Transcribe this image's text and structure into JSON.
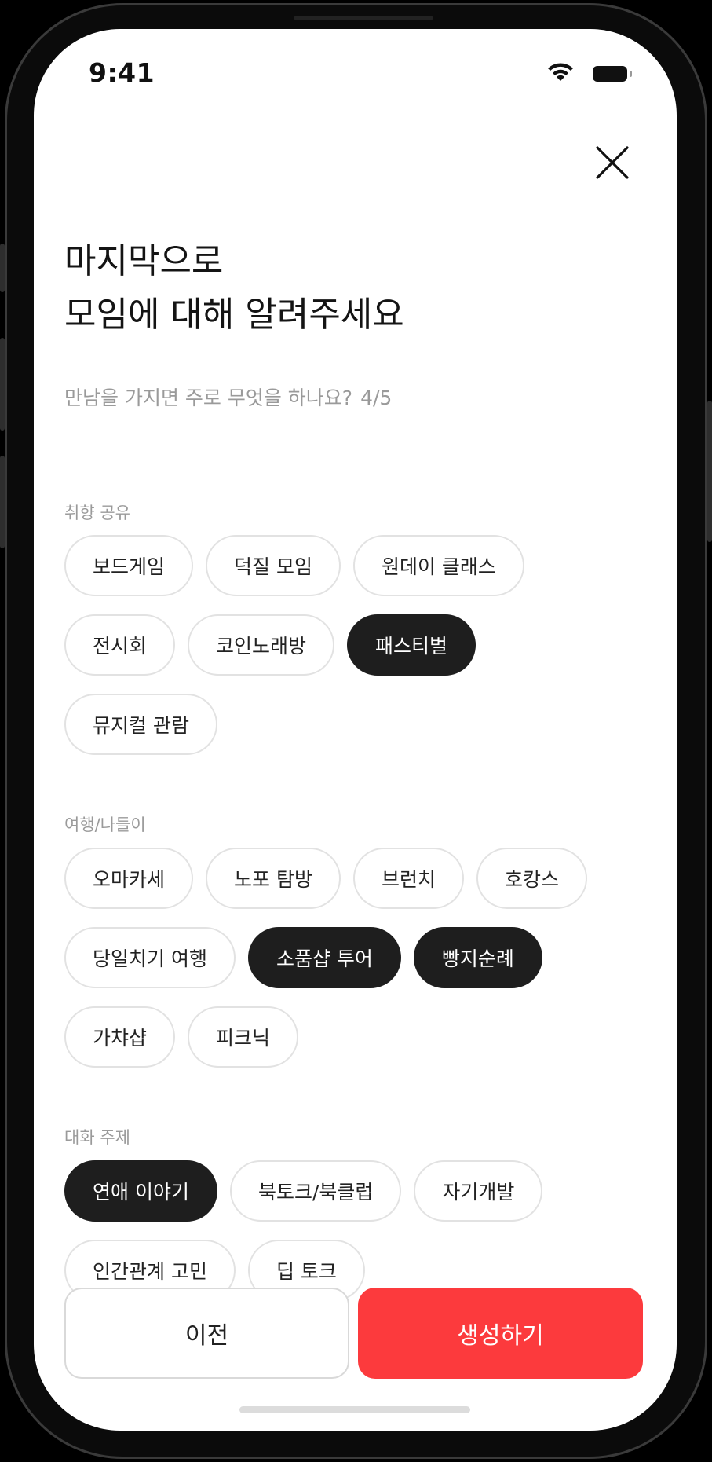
{
  "status_bar": {
    "time": "9:41"
  },
  "header": {
    "title_line1": "마지막으로",
    "title_line2": "모임에 대해 알려주세요",
    "subtitle": "만남을 가지면 주로 무엇을 하나요?",
    "step": "4/5"
  },
  "sections": [
    {
      "label": "취향 공유",
      "chips": [
        {
          "label": "보드게임",
          "selected": false
        },
        {
          "label": "덕질 모임",
          "selected": false
        },
        {
          "label": "원데이 클래스",
          "selected": false
        },
        {
          "label": "전시회",
          "selected": false
        },
        {
          "label": "코인노래방",
          "selected": false
        },
        {
          "label": "패스티벌",
          "selected": true
        },
        {
          "label": "뮤지컬 관람",
          "selected": false
        }
      ]
    },
    {
      "label": "여행/나들이",
      "chips": [
        {
          "label": "오마카세",
          "selected": false
        },
        {
          "label": "노포 탐방",
          "selected": false
        },
        {
          "label": "브런치",
          "selected": false
        },
        {
          "label": "호캉스",
          "selected": false
        },
        {
          "label": "당일치기 여행",
          "selected": false
        },
        {
          "label": "소품샵 투어",
          "selected": true
        },
        {
          "label": "빵지순례",
          "selected": true
        },
        {
          "label": "가챠샵",
          "selected": false
        },
        {
          "label": "피크닉",
          "selected": false
        }
      ]
    },
    {
      "label": "대화 주제",
      "chips": [
        {
          "label": "연애 이야기",
          "selected": true
        },
        {
          "label": "북토크/북클럽",
          "selected": false
        },
        {
          "label": "자기개발",
          "selected": false
        },
        {
          "label": "인간관계 고민",
          "selected": false
        },
        {
          "label": "딥 토크",
          "selected": false
        }
      ]
    }
  ],
  "footer": {
    "prev_label": "이전",
    "create_label": "생성하기"
  },
  "colors": {
    "accent": "#fc3a3d",
    "selected_chip": "#1e1e1e",
    "chip_border": "#e2e2e2"
  },
  "icons": {
    "close": "close-icon",
    "wifi": "wifi-icon",
    "battery": "battery-icon"
  }
}
